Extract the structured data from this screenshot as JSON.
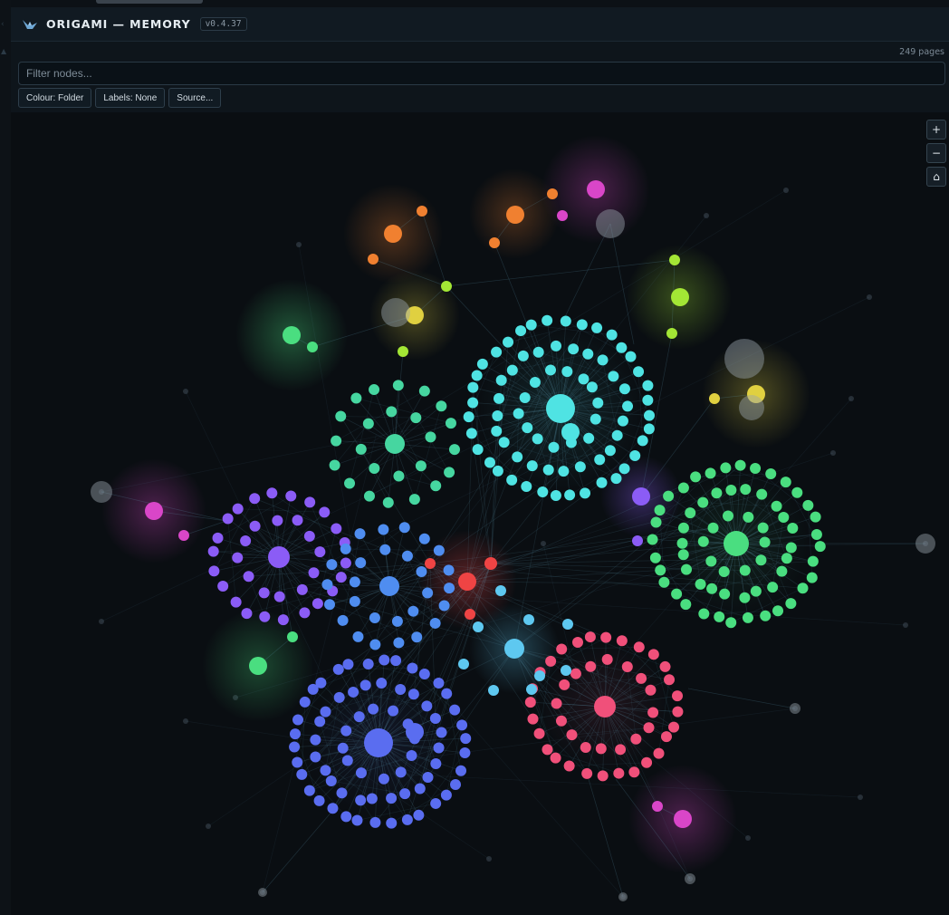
{
  "window": {
    "title": "ORIGAMI — MEMORY",
    "version": "v0.4.37"
  },
  "toolbar": {
    "page_count": "249 pages",
    "filter_placeholder": "Filter nodes...",
    "colour_button": "Colour: Folder",
    "labels_button": "Labels: None",
    "source_button": "Source..."
  },
  "zoom": {
    "zoom_in": "+",
    "zoom_out": "−",
    "home": "⌂"
  },
  "icons": {
    "app_logo": "crane-icon",
    "home": "home-icon"
  },
  "graph": {
    "type": "force-directed-graph",
    "colour_mode": "Folder",
    "clusters": [
      {
        "color": "#4fe3e3"
      },
      {
        "color": "#46d6a0"
      },
      {
        "color": "#4ade80"
      },
      {
        "color": "#8b5cf6"
      },
      {
        "color": "#5a6df0"
      },
      {
        "color": "#4f8df0"
      },
      {
        "color": "#f0507a"
      },
      {
        "color": "#ef4444"
      },
      {
        "color": "#d946c8"
      },
      {
        "color": "#e0d040"
      },
      {
        "color": "#a3e635"
      },
      {
        "color": "#f08030"
      },
      {
        "color": "#5ec8f0"
      },
      {
        "color": "#9aa3ac"
      }
    ]
  }
}
